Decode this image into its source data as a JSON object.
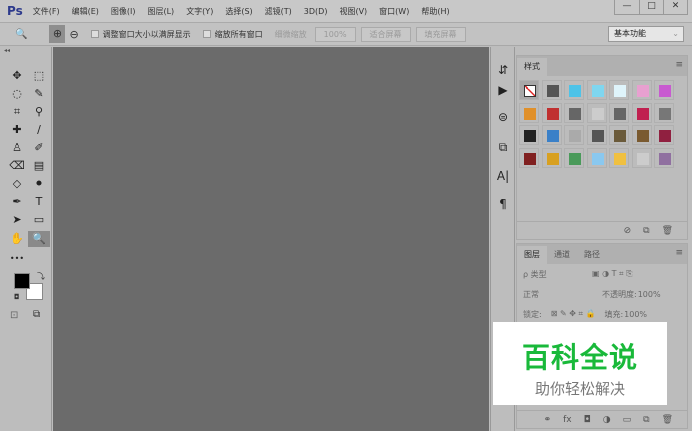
{
  "app": {
    "logo": "Ps"
  },
  "menu": [
    "文件(F)",
    "编辑(E)",
    "图像(I)",
    "图层(L)",
    "文字(Y)",
    "选择(S)",
    "滤镜(T)",
    "3D(D)",
    "视图(V)",
    "窗口(W)",
    "帮助(H)"
  ],
  "window_controls": {
    "minimize": "—",
    "maximize": "□",
    "close": "✕"
  },
  "options": {
    "zoom_tool": "🔍",
    "zoom_in": "⊕",
    "zoom_out": "⊖",
    "resize_windows": "调整窗口大小以满屏显示",
    "zoom_all": "缩放所有窗口",
    "scrubby": "细微缩放",
    "percent": "100%",
    "fit_screen": "适合屏幕",
    "fill_screen": "填充屏幕",
    "workspace": "基本功能"
  },
  "tools": [
    "✥",
    "⬚",
    "◌",
    "✎",
    "⌗",
    "⚲",
    "✚",
    "∕",
    "♙",
    "✐",
    "⌫",
    "▤",
    "◇",
    "⚫",
    "✒",
    "T",
    "➤",
    "▭",
    "✋",
    "🔍",
    "•••"
  ],
  "strip_icons": [
    "⇵",
    "▶",
    "⊜",
    "⧉",
    "A|",
    "¶"
  ],
  "styles_panel": {
    "tab": "样式",
    "menu": "≡",
    "swatches": [
      "#ffffff",
      "#555555",
      "#4ec3e8",
      "#7fd6ef",
      "#dff4fb",
      "#e8a0d0",
      "#c85ad0",
      "#e0902a",
      "#c03030",
      "#666666",
      "#cccccc",
      "#666666",
      "#c02050",
      "#777777",
      "#222222",
      "#3a80c8",
      "#aaaaaa",
      "#555555",
      "#6a5a3a",
      "#7a5a30",
      "#902040",
      "#802020",
      "#d8a020",
      "#4a9a5a",
      "#8ac8ef",
      "#f0c040",
      "#cccccc",
      "#9070a0"
    ]
  },
  "layers_panel": {
    "tabs": [
      "图层",
      "通道",
      "路径"
    ],
    "filter": "ρ 类型",
    "blend": "正常",
    "opacity_label": "不透明度:",
    "opacity": "100%",
    "lock_label": "锁定:",
    "fill_label": "填充:",
    "fill": "100%",
    "footer": [
      "⚭",
      "fx",
      "◘",
      "◑",
      "▭",
      "⧉",
      "🗑"
    ]
  },
  "styles_footer": [
    "⊘",
    "⧉",
    "🗑"
  ],
  "watermark": {
    "title": "百科全说",
    "subtitle": "助你轻松解决"
  }
}
